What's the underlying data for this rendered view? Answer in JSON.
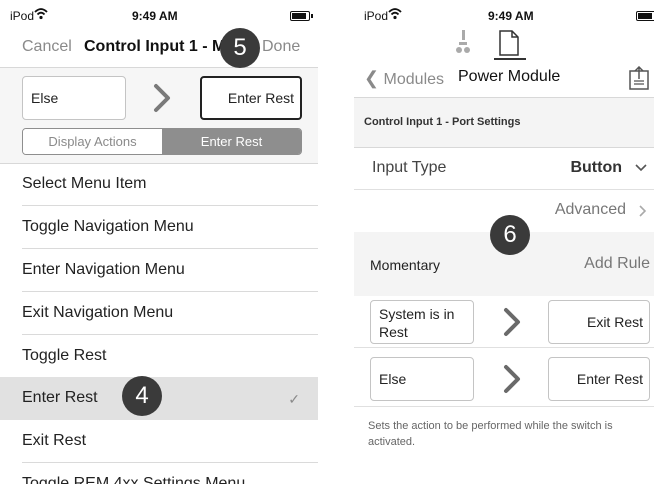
{
  "left": {
    "status": {
      "carrier": "iPod",
      "time": "9:49 AM"
    },
    "nav": {
      "cancel": "Cancel",
      "title": "Control Input 1 - M",
      "done": "Done"
    },
    "step_badge": "5",
    "rule": {
      "condition": "Else",
      "action": "Enter Rest"
    },
    "segment": {
      "option_a": "Display Actions",
      "option_b": "Enter Rest"
    },
    "menu": [
      "Select Menu Item",
      "Toggle Navigation Menu",
      "Enter Navigation Menu",
      "Exit Navigation Menu",
      "Toggle Rest",
      "Enter Rest",
      "Exit Rest",
      "Toggle REM 4xx Settings Menu"
    ],
    "selected_badge": "4"
  },
  "right": {
    "status": {
      "carrier": "iPod",
      "time": "9:49 AM"
    },
    "nav": {
      "back": "Modules",
      "title": "Power Module"
    },
    "section_header": "Control Input 1 - Port Settings",
    "input_type": {
      "label": "Input Type",
      "value": "Button"
    },
    "advanced": "Advanced",
    "step_badge": "6",
    "momentary": {
      "label": "Momentary",
      "action": "Add Rule"
    },
    "rules": [
      {
        "condition": "System is in Rest",
        "action": "Exit Rest"
      },
      {
        "condition": "Else",
        "action": "Enter Rest"
      }
    ],
    "footer": "Sets the action to be performed while the switch is activated."
  }
}
